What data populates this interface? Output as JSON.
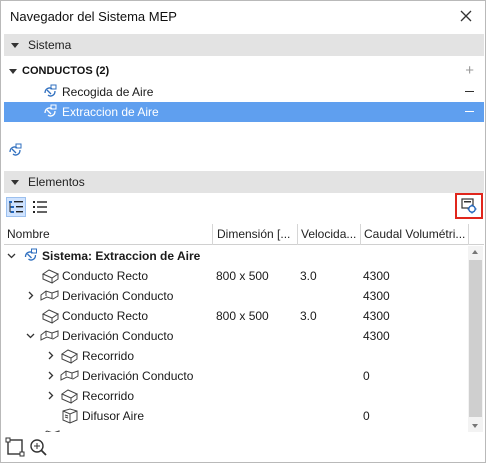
{
  "window": {
    "title": "Navegador del Sistema MEP"
  },
  "sistema_section": {
    "header": "Sistema",
    "group_label": "CONDUCTOS (2)",
    "items": [
      {
        "label": "Recogida de Aire",
        "selected": false
      },
      {
        "label": "Extraccion de Aire",
        "selected": true
      }
    ]
  },
  "elementos_section": {
    "header": "Elementos"
  },
  "table": {
    "columns": [
      "Nombre",
      "Dimensión [...",
      "Velocida...",
      "Caudal Volumétri..."
    ],
    "rows": [
      {
        "name": "Sistema: Extraccion de Aire",
        "dim": "",
        "vel": "",
        "caudal": "",
        "expanded": true
      },
      {
        "name": "Conducto Recto",
        "dim": "800 x 500",
        "vel": "3.0",
        "caudal": "4300"
      },
      {
        "name": "Derivación Conducto",
        "dim": "",
        "vel": "",
        "caudal": "4300",
        "expanded": false
      },
      {
        "name": "Conducto Recto",
        "dim": "800 x 500",
        "vel": "3.0",
        "caudal": "4300"
      },
      {
        "name": "Derivación Conducto",
        "dim": "",
        "vel": "",
        "caudal": "4300",
        "expanded": true
      },
      {
        "name": "Recorrido",
        "dim": "",
        "vel": "",
        "caudal": "",
        "expanded": false
      },
      {
        "name": "Derivación Conducto",
        "dim": "",
        "vel": "",
        "caudal": "0",
        "expanded": false
      },
      {
        "name": "Recorrido",
        "dim": "",
        "vel": "",
        "caudal": "",
        "expanded": false
      },
      {
        "name": "Difusor Aire",
        "dim": "",
        "vel": "",
        "caudal": "0"
      }
    ]
  },
  "colors": {
    "selection": "#5f9fef",
    "section_bg": "#e3e3e3",
    "highlight_border": "#e0261c"
  },
  "icons": [
    "close-icon",
    "system-icon",
    "tree-view-icon",
    "list-view-icon",
    "settings-icon",
    "duct-icon",
    "fitting-icon",
    "frame-select-icon",
    "zoom-to-icon"
  ]
}
